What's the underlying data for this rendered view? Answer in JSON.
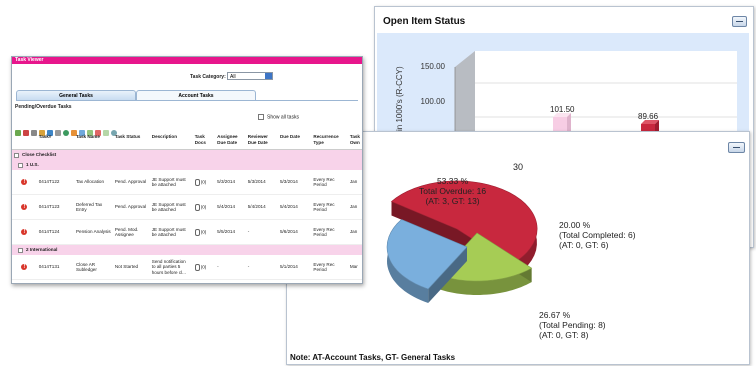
{
  "open_item_status": {
    "title": "Open Item Status",
    "ylabel": "in 1000's (R-CCY)",
    "y_ticks": [
      "150.00",
      "100.00"
    ],
    "bar_values": [
      "101.50",
      "89.66"
    ],
    "colors": {
      "plot_bg": "#dbe9fb",
      "bar1": "#f7cde4",
      "bar2": "#c8283e"
    }
  },
  "pie_panel": {
    "top_value": "30",
    "note": "Note: AT-Account Tasks, GT- General Tasks",
    "chart_data": {
      "type": "pie",
      "slices": [
        {
          "percent": "53.33 %",
          "label": "Total Overdue: 16",
          "detail": "(AT: 3, GT: 13)",
          "value": 53.33,
          "color": "#c8283e"
        },
        {
          "percent": "20.00 %",
          "label": "(Total Completed: 6)",
          "detail": "(AT: 0, GT: 6)",
          "value": 20.0,
          "color": "#a6cc55"
        },
        {
          "percent": "26.67 %",
          "label": "(Total Pending: 8)",
          "detail": "(AT: 0, GT: 8)",
          "value": 26.67,
          "color": "#7aafdd"
        }
      ]
    }
  },
  "task_viewer": {
    "title": "Task Viewer",
    "category_label": "Task Category:",
    "category_value": "All",
    "tabs": [
      "General Tasks",
      "Account Tasks"
    ],
    "section_title": "Pending/Overdue Tasks",
    "show_all_label": "Show all tasks",
    "columns": [
      "Task#",
      "Task Name",
      "Task Status",
      "Description",
      "Task Docs",
      "Assignee Due Date",
      "Reviewer Due Date",
      "Due Date",
      "Recurrence Type",
      "Task Own"
    ],
    "groups": {
      "close_checklist": "Close Checklist",
      "us": "1 U.S.",
      "international": "2 International"
    },
    "rows": [
      {
        "id": "0414T122",
        "name": "Tax Allocation",
        "status": "Pend. Approval",
        "desc": "JE Support must be attached",
        "docs": "(0)",
        "assignee": "5/3/2014",
        "reviewer": "5/3/2014",
        "due": "5/3/2014",
        "recurrence": "Every Rec Period",
        "owner": "Jan"
      },
      {
        "id": "0414T123",
        "name": "Deferred Tax Entry",
        "status": "Pend. Approval",
        "desc": "JE Support must be attached",
        "docs": "(0)",
        "assignee": "5/4/2014",
        "reviewer": "5/4/2014",
        "due": "5/4/2014",
        "recurrence": "Every Rec Period",
        "owner": "Jan"
      },
      {
        "id": "0414T124",
        "name": "Pension Analysis",
        "status": "Pend. Mod. Assignee",
        "desc": "JE Support must be attached",
        "docs": "(0)",
        "assignee": "5/5/2014",
        "reviewer": "-",
        "due": "5/6/2014",
        "recurrence": "Every Rec Period",
        "owner": "Jan"
      },
      {
        "id": "0414T131",
        "name": "Close AR Subledger",
        "status": "Not Started",
        "desc": "Send notification to all parties 5 hours before cl...",
        "docs": "(0)",
        "assignee": "-",
        "reviewer": "-",
        "due": "5/1/2014",
        "recurrence": "Every Rec Period",
        "owner": "Mar"
      }
    ]
  }
}
